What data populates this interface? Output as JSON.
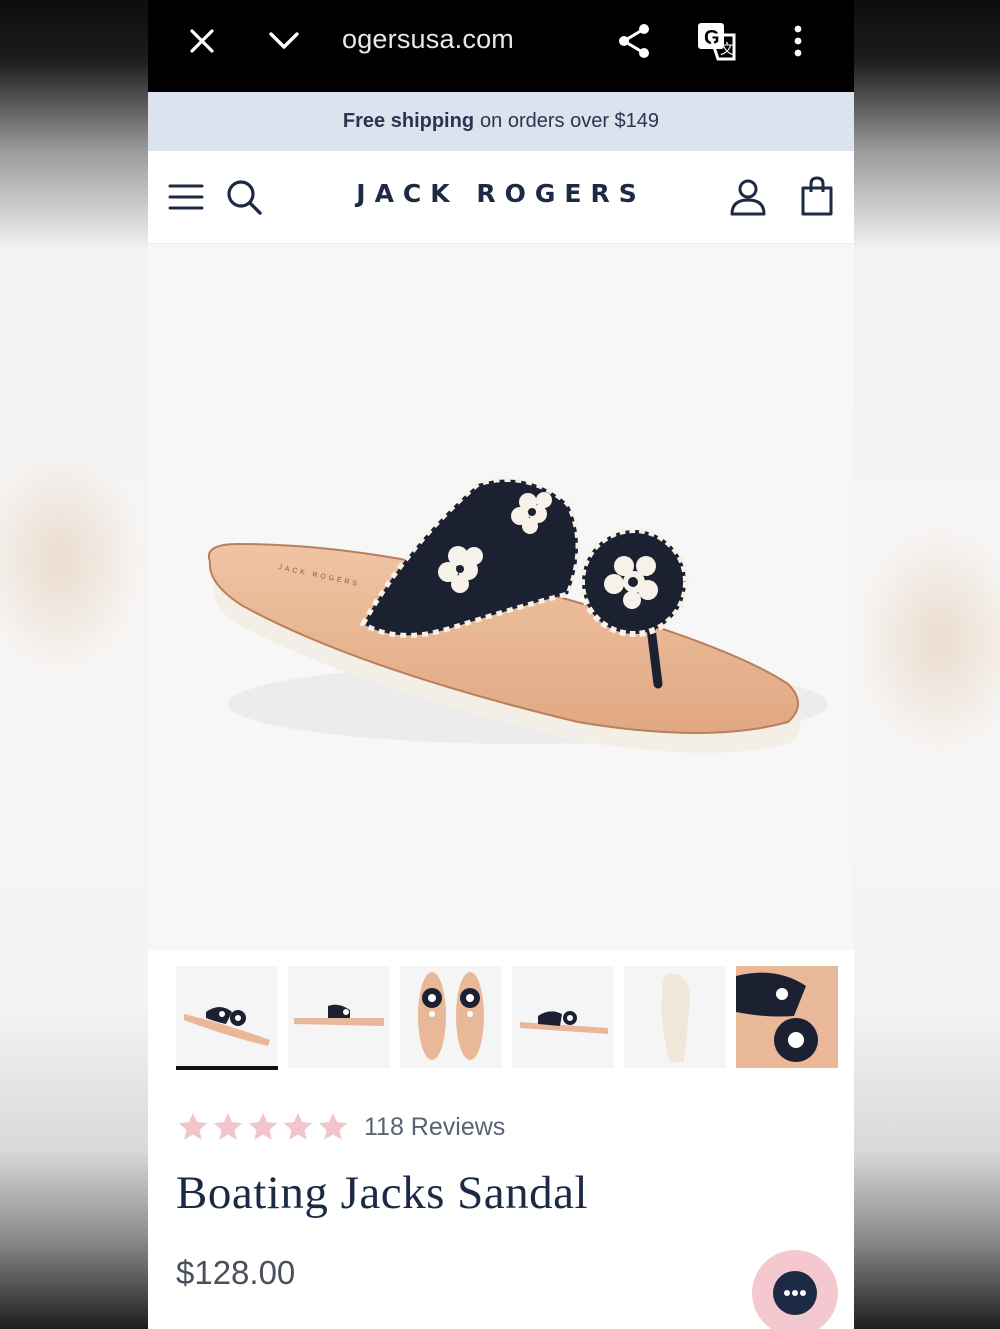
{
  "browser": {
    "url": "ogersusa.com",
    "icons": [
      "close-icon",
      "chevron-down-icon",
      "share-icon",
      "translate-icon",
      "more-vertical-icon"
    ]
  },
  "promo": {
    "bold": "Free shipping",
    "rest": "on orders over $149"
  },
  "header": {
    "logo": "JACK ROGERS",
    "icons": [
      "menu-icon",
      "search-icon",
      "account-icon",
      "bag-icon"
    ]
  },
  "product": {
    "rating": 5,
    "reviews": "118 Reviews",
    "title": "Boating Jacks Sandal",
    "price": "$128.00",
    "thumbnail_count": 6,
    "selected_thumbnail": 1
  },
  "colors": {
    "brand_navy": "#1d2a44",
    "promo_bg": "#dbe3ee",
    "star_pink": "#f2c4cb",
    "chat_bg": "#f3c9cf"
  }
}
